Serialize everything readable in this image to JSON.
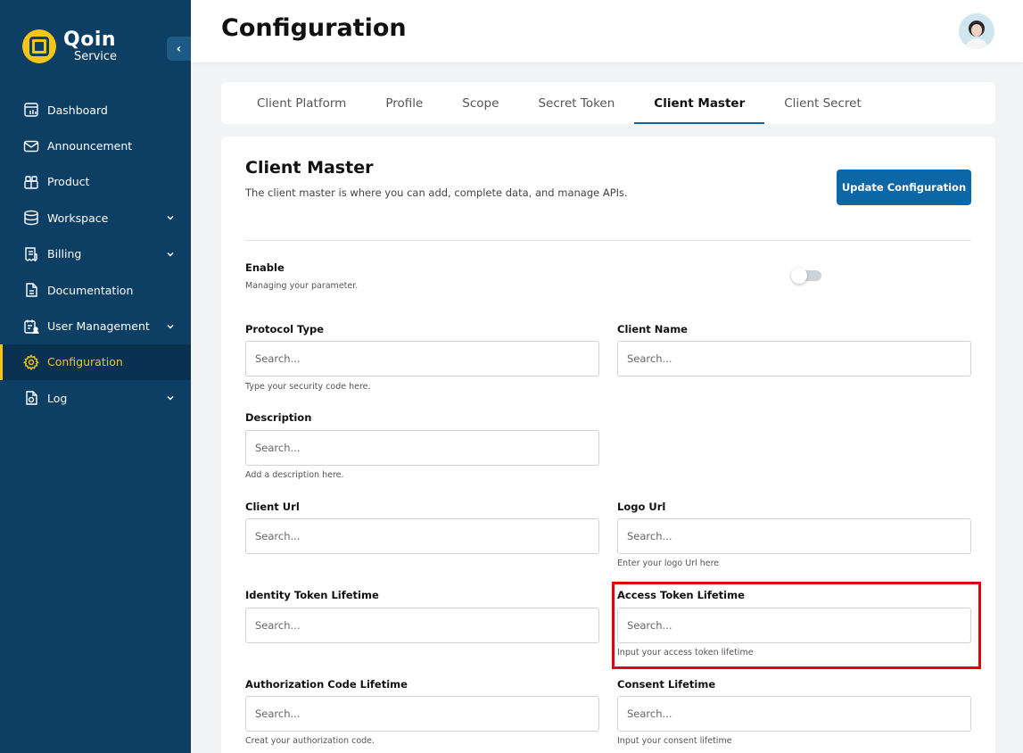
{
  "brand": {
    "name": "Qoin",
    "sub": "Service",
    "collapse_glyph": "‹"
  },
  "sidebar": {
    "items": [
      {
        "label": "Dashboard",
        "icon": "dashboard-icon",
        "chevron": false
      },
      {
        "label": "Announcement",
        "icon": "mail-icon",
        "chevron": false
      },
      {
        "label": "Product",
        "icon": "box-icon",
        "chevron": false
      },
      {
        "label": "Workspace",
        "icon": "database-icon",
        "chevron": true
      },
      {
        "label": "Billing",
        "icon": "receipt-icon",
        "chevron": true
      },
      {
        "label": "Documentation",
        "icon": "document-icon",
        "chevron": false
      },
      {
        "label": "User Management",
        "icon": "user-list-icon",
        "chevron": true
      },
      {
        "label": "Configuration",
        "icon": "gear-icon",
        "chevron": false,
        "active": true
      },
      {
        "label": "Log",
        "icon": "log-icon",
        "chevron": true
      }
    ]
  },
  "header": {
    "title": "Configuration"
  },
  "tabs": [
    {
      "label": "Client Platform"
    },
    {
      "label": "Profile"
    },
    {
      "label": "Scope"
    },
    {
      "label": "Secret Token"
    },
    {
      "label": "Client Master",
      "active": true
    },
    {
      "label": "Client Secret"
    }
  ],
  "card": {
    "title": "Client Master",
    "subtitle": "The client master  is where you can add, complete data, and manage APIs.",
    "update_button": "Update Configuration"
  },
  "enable": {
    "label": "Enable",
    "help": "Managing your parameter.",
    "on": false
  },
  "fields": {
    "protocol_type": {
      "label": "Protocol Type",
      "placeholder": "Search...",
      "help": "Type your security code here."
    },
    "client_name": {
      "label": "Client Name",
      "placeholder": "Search..."
    },
    "description": {
      "label": "Description",
      "placeholder": "Search...",
      "help": "Add a description here."
    },
    "client_url": {
      "label": "Client Url",
      "placeholder": "Search..."
    },
    "logo_url": {
      "label": "Logo Url",
      "placeholder": "Search...",
      "help": "Enter your logo Url here"
    },
    "identity_token": {
      "label": "Identity Token Lifetime",
      "placeholder": "Search..."
    },
    "access_token": {
      "label": "Access Token Lifetime",
      "placeholder": "Search...",
      "help": "Input your access token lifetime"
    },
    "auth_code": {
      "label": "Authorization Code Lifetime",
      "placeholder": "Search...",
      "help": "Creat your authorization code."
    },
    "consent": {
      "label": "Consent Lifetime",
      "placeholder": "Search...",
      "help": "Input your consent lifetime"
    }
  },
  "colors": {
    "sidebar": "#0d3e63",
    "accent": "#0d67a6",
    "active_nav": "#f5c518",
    "highlight": "#e4000f"
  }
}
